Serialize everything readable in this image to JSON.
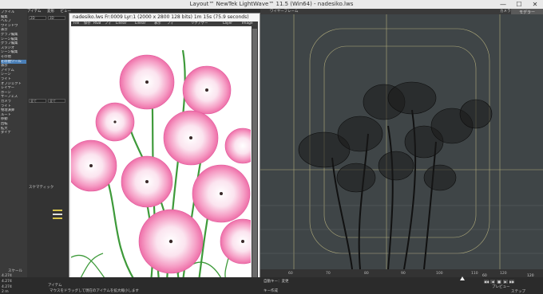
{
  "window": {
    "title": "Layout™ NewTek LightWave™ 11.5 (Win64) - nadesiko.lws",
    "minimize": "—",
    "maximize": "☐",
    "close": "✕",
    "top_right_tab": "モデラー"
  },
  "left_panel": {
    "items": [
      {
        "label": "ファイル"
      },
      {
        "label": "編集"
      },
      {
        "label": "ヘルプ"
      },
      {
        "label": "ウインドウ"
      },
      {
        "label": "表示"
      },
      {
        "label": "グラフ編集"
      },
      {
        "label": "シーン編集"
      },
      {
        "label": "グラフ編集"
      },
      {
        "label": "スタジオ"
      },
      {
        "label": "シーン編集"
      },
      {
        "label": "その他"
      },
      {
        "label": "その他ツール",
        "selected": true
      },
      {
        "label": "表示"
      },
      {
        "label": "アイテム"
      },
      {
        "label": "シーン"
      },
      {
        "label": "ライト"
      },
      {
        "label": "オブジェクト"
      },
      {
        "label": "レイヤー"
      },
      {
        "label": "ボーン"
      },
      {
        "label": "サーフェス"
      },
      {
        "label": "カメラ"
      },
      {
        "label": "ライト"
      },
      {
        "label": "物理演算"
      },
      {
        "label": "ルート"
      },
      {
        "label": "移動"
      },
      {
        "label": "回転"
      },
      {
        "label": "拡大"
      },
      {
        "label": "ダイナ"
      }
    ],
    "section_labels": [
      "ツール",
      "移動",
      "選択",
      "生成"
    ]
  },
  "mid_column": {
    "tabs": [
      "アイテム",
      "変形",
      "ビュー"
    ],
    "fields": [
      "2D",
      "3D",
      "全て",
      "全て",
      "カメラ",
      "選択"
    ],
    "schematic": "スケマティック",
    "perspective": "パースペクティブ"
  },
  "render_window": {
    "title": "nadesiko.lws Fr:0009 Lyr:1  (2000 x 2800 128 bits) 1m 15s (75.9 seconds)",
    "menu": [
      "File",
      "保存",
      "RGB",
      "フィ",
      "Linear",
      "Linear",
      "表示",
      "フィ",
      "リクアゲー",
      "Layer",
      "Image"
    ]
  },
  "right_view": {
    "header_label": "ワイヤーフレーム",
    "view_label": "カメラ"
  },
  "ruler": {
    "ticks": [
      "60",
      "70",
      "80",
      "90",
      "100",
      "110",
      "120"
    ]
  },
  "bottom": {
    "scale_label": "スケール",
    "values": [
      "4.274",
      "4.274",
      "4.274"
    ],
    "step_label": "2 m",
    "status": "マウスをドラッグして現在のアイテムを拡大縮小します",
    "key_label": "キー",
    "item_label": "アイテム",
    "auto_key": "自動キー：変更",
    "preview": "プレビュー",
    "step": "ステップ",
    "frame_start": "60",
    "frame_end": "120",
    "end_label": "終了",
    "create_key": "キー作成"
  }
}
